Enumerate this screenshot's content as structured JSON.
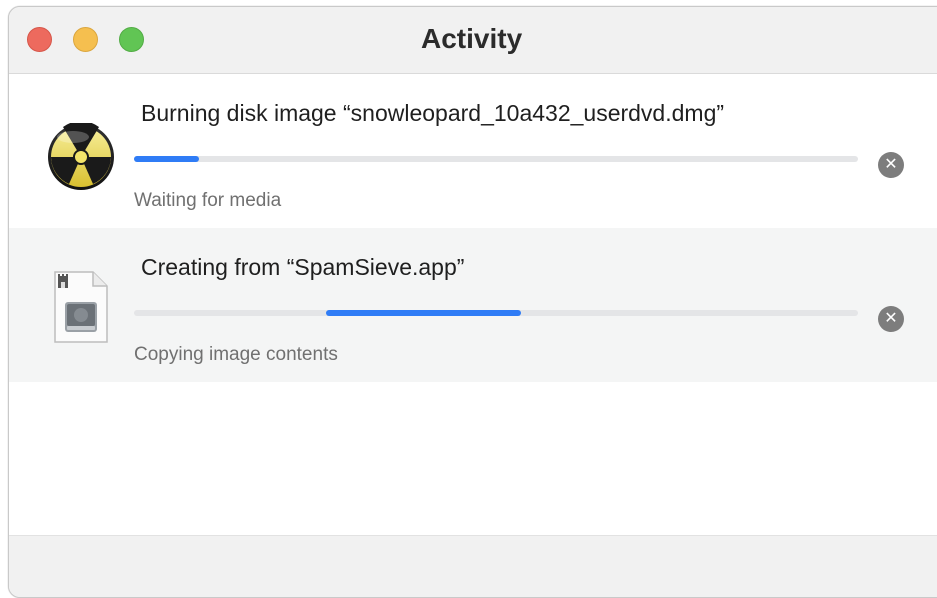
{
  "window": {
    "title": "Activity"
  },
  "activities": [
    {
      "title": "Burning disk image “snowleopard_10a432_userdvd.dmg”",
      "status": "Waiting for media",
      "progress": 0.09,
      "progress_start": 0.0,
      "icon": "burn-disc-icon"
    },
    {
      "title": "Creating from “SpamSieve.app”",
      "status": "Copying image contents",
      "progress": 0.27,
      "progress_start": 0.265,
      "icon": "disk-image-document-icon"
    }
  ],
  "colors": {
    "progress_fill": "#2f7cf6",
    "progress_track": "#e4e5e7",
    "close": "#ed6a5e",
    "minimize": "#f5bf4f",
    "zoom": "#61c554",
    "row_alt_background": "#f4f5f5"
  },
  "stop_icon": "x-circle-icon"
}
